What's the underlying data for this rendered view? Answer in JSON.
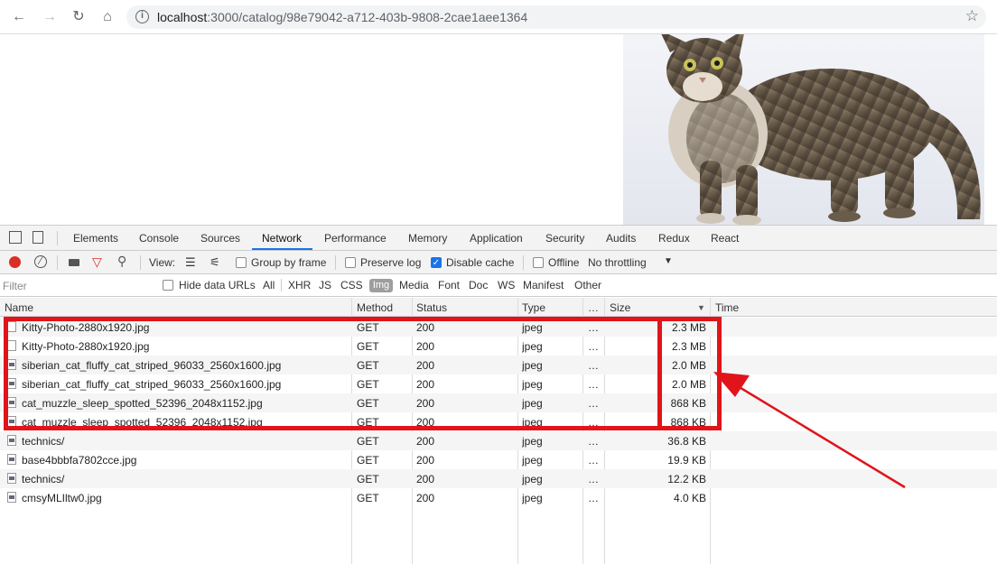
{
  "browser": {
    "url_host": "localhost",
    "url_rest": ":3000/catalog/98e79042-a712-403b-9808-2cae1aee1364",
    "nav": [
      "back-icon",
      "forward-icon",
      "reload-icon",
      "home-icon"
    ]
  },
  "devtools": {
    "tabs": [
      {
        "label": "Elements"
      },
      {
        "label": "Console"
      },
      {
        "label": "Sources"
      },
      {
        "label": "Network"
      },
      {
        "label": "Performance"
      },
      {
        "label": "Memory"
      },
      {
        "label": "Application"
      },
      {
        "label": "Security"
      },
      {
        "label": "Audits"
      },
      {
        "label": "Redux"
      },
      {
        "label": "React"
      }
    ],
    "active_tab": "Network",
    "netbar": {
      "view_label": "View:",
      "group_by_frame": "Group by frame",
      "preserve_log": "Preserve log",
      "disable_cache": "Disable cache",
      "offline": "Offline",
      "throttling": "No throttling"
    },
    "filterbar": {
      "placeholder": "Filter",
      "hide_data_urls": "Hide data URLs",
      "types": [
        "All",
        "XHR",
        "JS",
        "CSS",
        "Img",
        "Media",
        "Font",
        "Doc",
        "WS",
        "Manifest",
        "Other"
      ],
      "active_type": "Img"
    },
    "columns": {
      "name": "Name",
      "method": "Method",
      "status": "Status",
      "type": "Type",
      "more": "…",
      "size": "Size",
      "time": "Time"
    },
    "rows": [
      {
        "name": "Kitty-Photo-2880x1920.jpg",
        "method": "GET",
        "status": "200",
        "type": "jpeg",
        "more": "…",
        "size": "2.3 MB",
        "icon": "blank"
      },
      {
        "name": "Kitty-Photo-2880x1920.jpg",
        "method": "GET",
        "status": "200",
        "type": "jpeg",
        "more": "…",
        "size": "2.3 MB",
        "icon": "blank"
      },
      {
        "name": "siberian_cat_fluffy_cat_striped_96033_2560x1600.jpg",
        "method": "GET",
        "status": "200",
        "type": "jpeg",
        "more": "…",
        "size": "2.0 MB",
        "icon": "img"
      },
      {
        "name": "siberian_cat_fluffy_cat_striped_96033_2560x1600.jpg",
        "method": "GET",
        "status": "200",
        "type": "jpeg",
        "more": "…",
        "size": "2.0 MB",
        "icon": "img"
      },
      {
        "name": "cat_muzzle_sleep_spotted_52396_2048x1152.jpg",
        "method": "GET",
        "status": "200",
        "type": "jpeg",
        "more": "…",
        "size": "868 KB",
        "icon": "img"
      },
      {
        "name": "cat_muzzle_sleep_spotted_52396_2048x1152.jpg",
        "method": "GET",
        "status": "200",
        "type": "jpeg",
        "more": "…",
        "size": "868 KB",
        "icon": "img"
      },
      {
        "name": "technics/",
        "method": "GET",
        "status": "200",
        "type": "jpeg",
        "more": "…",
        "size": "36.8 KB",
        "icon": "img"
      },
      {
        "name": "base4bbbfa7802cce.jpg",
        "method": "GET",
        "status": "200",
        "type": "jpeg",
        "more": "…",
        "size": "19.9 KB",
        "icon": "img"
      },
      {
        "name": "technics/",
        "method": "GET",
        "status": "200",
        "type": "jpeg",
        "more": "…",
        "size": "12.2 KB",
        "icon": "img"
      },
      {
        "name": "cmsyMLIltw0.jpg",
        "method": "GET",
        "status": "200",
        "type": "jpeg",
        "more": "…",
        "size": "4.0 KB",
        "icon": "img"
      }
    ]
  },
  "colors": {
    "accent": "#1a73e8",
    "annotation": "#e0141a",
    "record": "#d93025"
  }
}
